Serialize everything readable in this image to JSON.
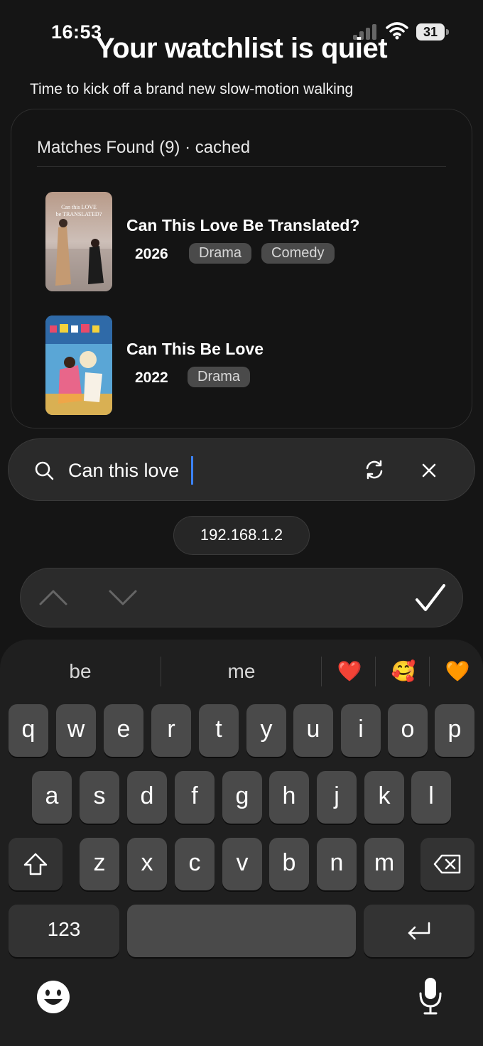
{
  "status_bar": {
    "time": "16:53",
    "battery": "31"
  },
  "header": {
    "title": "Your watchlist is quiet",
    "subtitle": "Time to kick off a brand new slow-motion walking"
  },
  "results": {
    "heading": "Matches Found (9) · cached",
    "items": [
      {
        "title": "Can This Love Be Translated?",
        "year": "2026",
        "tags": [
          "Drama",
          "Comedy"
        ],
        "poster_text": "Can this LOVE be TRANSLATED?"
      },
      {
        "title": "Can This Be Love",
        "year": "2022",
        "tags": [
          "Drama"
        ]
      }
    ]
  },
  "search": {
    "value": "Can this love"
  },
  "server": {
    "ip": "192.168.1.2"
  },
  "keyboard": {
    "suggestions": [
      "be",
      "me"
    ],
    "emoji_suggestions": [
      "❤️",
      "🥰",
      "🧡"
    ],
    "row1": [
      "q",
      "w",
      "e",
      "r",
      "t",
      "y",
      "u",
      "i",
      "o",
      "p"
    ],
    "row2": [
      "a",
      "s",
      "d",
      "f",
      "g",
      "h",
      "j",
      "k",
      "l"
    ],
    "row3": [
      "z",
      "x",
      "c",
      "v",
      "b",
      "n",
      "m"
    ],
    "numbers_label": "123"
  },
  "colors": {
    "background": "#151515",
    "caret": "#3b82f6",
    "tag_bg": "#4a4a4a",
    "key_bg": "#4a4a4a"
  }
}
